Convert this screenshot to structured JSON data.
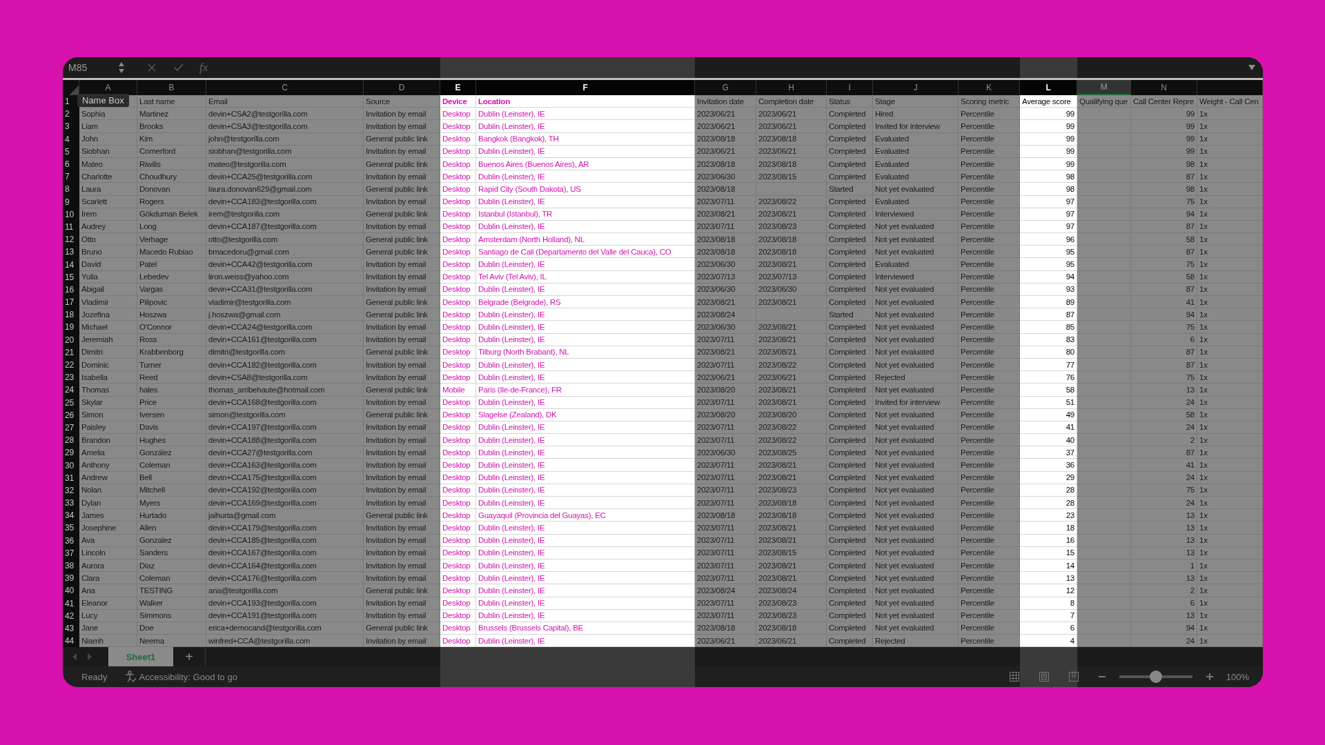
{
  "formula_bar": {
    "name_box": "M85",
    "function_label": "fx",
    "tooltip": "Name Box"
  },
  "columns": [
    {
      "letter": "A",
      "highlighted": false,
      "selected": false,
      "kind": "text"
    },
    {
      "letter": "B",
      "highlighted": false,
      "selected": false,
      "kind": "text"
    },
    {
      "letter": "C",
      "highlighted": false,
      "selected": false,
      "kind": "text"
    },
    {
      "letter": "D",
      "highlighted": false,
      "selected": false,
      "kind": "text"
    },
    {
      "letter": "E",
      "highlighted": true,
      "selected": false,
      "kind": "text",
      "color": "#d40fae"
    },
    {
      "letter": "F",
      "highlighted": true,
      "selected": false,
      "kind": "text",
      "color": "#d40fae"
    },
    {
      "letter": "G",
      "highlighted": false,
      "selected": false,
      "kind": "text"
    },
    {
      "letter": "H",
      "highlighted": false,
      "selected": false,
      "kind": "text"
    },
    {
      "letter": "I",
      "highlighted": false,
      "selected": false,
      "kind": "text"
    },
    {
      "letter": "J",
      "highlighted": false,
      "selected": false,
      "kind": "text"
    },
    {
      "letter": "K",
      "highlighted": false,
      "selected": false,
      "kind": "text"
    },
    {
      "letter": "L",
      "highlighted": true,
      "selected": false,
      "kind": "number"
    },
    {
      "letter": "M",
      "highlighted": false,
      "selected": true,
      "kind": "text"
    },
    {
      "letter": "N",
      "highlighted": false,
      "selected": false,
      "kind": "number"
    },
    {
      "highlighted": false,
      "selected": false,
      "kind": "text"
    }
  ],
  "rows": [
    {
      "n": "1",
      "cells": [
        null,
        "Last name",
        "Email",
        "Source",
        "Device",
        "Location",
        "Invitation date",
        "Completion date",
        "Status",
        "Stage",
        "Scoring metric",
        "Average score",
        "Qualifying que",
        "Call Center Repre",
        "Weight - Call Cen"
      ]
    },
    {
      "n": "2",
      "cells": [
        "Sophia",
        "Martinez",
        "devin+CSA2@testgorilla.com",
        "Invitation by email",
        "Desktop",
        "Dublin (Leinster), IE",
        "2023/06/21",
        "2023/06/21",
        "Completed",
        "Hired",
        "Percentile",
        "99",
        null,
        "99",
        "1x"
      ]
    },
    {
      "n": "3",
      "cells": [
        "Liam",
        "Brooks",
        "devin+CSA3@testgorilla.com",
        "Invitation by email",
        "Desktop",
        "Dublin (Leinster), IE",
        "2023/06/21",
        "2023/06/21",
        "Completed",
        "Invited for interview",
        "Percentile",
        "99",
        null,
        "99",
        "1x"
      ]
    },
    {
      "n": "4",
      "cells": [
        "John",
        "Kim",
        "john@testgorilla.com",
        "General public link",
        "Desktop",
        "Bangkok (Bangkok), TH",
        "2023/08/18",
        "2023/08/18",
        "Completed",
        "Evaluated",
        "Percentile",
        "99",
        null,
        "99",
        "1x"
      ]
    },
    {
      "n": "5",
      "cells": [
        "Siobhan",
        "Comerford",
        "siobhan@testgorilla.com",
        "Invitation by email",
        "Desktop",
        "Dublin (Leinster), IE",
        "2023/06/21",
        "2023/06/21",
        "Completed",
        "Evaluated",
        "Percentile",
        "99",
        null,
        "99",
        "1x"
      ]
    },
    {
      "n": "6",
      "cells": [
        "Mateo",
        "Riwilis",
        "mateo@testgorilla.com",
        "General public link",
        "Desktop",
        "Buenos Aires (Buenos Aires), AR",
        "2023/08/18",
        "2023/08/18",
        "Completed",
        "Evaluated",
        "Percentile",
        "99",
        null,
        "98",
        "1x"
      ]
    },
    {
      "n": "7",
      "cells": [
        "Charlotte",
        "Choudhury",
        "devin+CCA25@testgorilla.com",
        "Invitation by email",
        "Desktop",
        "Dublin (Leinster), IE",
        "2023/06/30",
        "2023/08/15",
        "Completed",
        "Evaluated",
        "Percentile",
        "98",
        null,
        "87",
        "1x"
      ]
    },
    {
      "n": "8",
      "cells": [
        "Laura",
        "Donovan",
        "laura.donovan629@gmail.com",
        "General public link",
        "Desktop",
        "Rapid City (South Dakota), US",
        "2023/08/18",
        null,
        "Started",
        "Not yet evaluated",
        "Percentile",
        "98",
        null,
        "98",
        "1x"
      ]
    },
    {
      "n": "9",
      "cells": [
        "Scarlett",
        "Rogers",
        "devin+CCA183@testgorilla.com",
        "Invitation by email",
        "Desktop",
        "Dublin (Leinster), IE",
        "2023/07/11",
        "2023/08/22",
        "Completed",
        "Evaluated",
        "Percentile",
        "97",
        null,
        "75",
        "1x"
      ]
    },
    {
      "n": "10",
      "cells": [
        "İrem",
        "Gökduman Belek",
        "irem@testgorilla.com",
        "General public link",
        "Desktop",
        "Istanbul (Istanbul), TR",
        "2023/08/21",
        "2023/08/21",
        "Completed",
        "Interviewed",
        "Percentile",
        "97",
        null,
        "94",
        "1x"
      ]
    },
    {
      "n": "11",
      "cells": [
        "Audrey",
        "Long",
        "devin+CCA187@testgorilla.com",
        "Invitation by email",
        "Desktop",
        "Dublin (Leinster), IE",
        "2023/07/11",
        "2023/08/23",
        "Completed",
        "Not yet evaluated",
        "Percentile",
        "97",
        null,
        "87",
        "1x"
      ]
    },
    {
      "n": "12",
      "cells": [
        "Otto",
        "Verhage",
        "otto@testgorilla.com",
        "General public link",
        "Desktop",
        "Amsterdam (North Holland), NL",
        "2023/08/18",
        "2023/08/18",
        "Completed",
        "Not yet evaluated",
        "Percentile",
        "96",
        null,
        "58",
        "1x"
      ]
    },
    {
      "n": "13",
      "cells": [
        "Bruno",
        "Macedo Rubiao",
        "bmacedoru@gmail.com",
        "General public link",
        "Desktop",
        "Santiago de Cali (Departamento del Valle del Cauca), CO",
        "2023/08/18",
        "2023/08/18",
        "Completed",
        "Not yet evaluated",
        "Percentile",
        "95",
        null,
        "87",
        "1x"
      ]
    },
    {
      "n": "14",
      "cells": [
        "David",
        "Patel",
        "devin+CCA42@testgorilla.com",
        "Invitation by email",
        "Desktop",
        "Dublin (Leinster), IE",
        "2023/06/30",
        "2023/08/21",
        "Completed",
        "Evaluated",
        "Percentile",
        "95",
        null,
        "75",
        "1x"
      ]
    },
    {
      "n": "15",
      "cells": [
        "Yulia",
        "Lebedev",
        "liron.weiss@yahoo.com",
        "Invitation by email",
        "Desktop",
        "Tel Aviv (Tel Aviv), IL",
        "2023/07/13",
        "2023/07/13",
        "Completed",
        "Interviewed",
        "Percentile",
        "94",
        null,
        "58",
        "1x"
      ]
    },
    {
      "n": "16",
      "cells": [
        "Abigail",
        "Vargas",
        "devin+CCA31@testgorilla.com",
        "Invitation by email",
        "Desktop",
        "Dublin (Leinster), IE",
        "2023/06/30",
        "2023/06/30",
        "Completed",
        "Not yet evaluated",
        "Percentile",
        "93",
        null,
        "87",
        "1x"
      ]
    },
    {
      "n": "17",
      "cells": [
        "Vladimir",
        "Pilipovic",
        "vladimir@testgorilla.com",
        "General public link",
        "Desktop",
        "Belgrade (Belgrade), RS",
        "2023/08/21",
        "2023/08/21",
        "Completed",
        "Not yet evaluated",
        "Percentile",
        "89",
        null,
        "41",
        "1x"
      ]
    },
    {
      "n": "18",
      "cells": [
        "Jozefina",
        "Hoszwa",
        "j.hoszwa@gmail.com",
        "General public link",
        "Desktop",
        "Dublin (Leinster), IE",
        "2023/08/24",
        null,
        "Started",
        "Not yet evaluated",
        "Percentile",
        "87",
        null,
        "94",
        "1x"
      ]
    },
    {
      "n": "19",
      "cells": [
        "Michael",
        "O'Connor",
        "devin+CCA24@testgorilla.com",
        "Invitation by email",
        "Desktop",
        "Dublin (Leinster), IE",
        "2023/06/30",
        "2023/08/21",
        "Completed",
        "Not yet evaluated",
        "Percentile",
        "85",
        null,
        "75",
        "1x"
      ]
    },
    {
      "n": "20",
      "cells": [
        "Jeremiah",
        "Ross",
        "devin+CCA161@testgorilla.com",
        "Invitation by email",
        "Desktop",
        "Dublin (Leinster), IE",
        "2023/07/11",
        "2023/08/21",
        "Completed",
        "Not yet evaluated",
        "Percentile",
        "83",
        null,
        "6",
        "1x"
      ]
    },
    {
      "n": "21",
      "cells": [
        "Dimitri",
        "Krabbenborg",
        "dimitri@testgorilla.com",
        "General public link",
        "Desktop",
        "Tilburg (North Brabant), NL",
        "2023/08/21",
        "2023/08/21",
        "Completed",
        "Not yet evaluated",
        "Percentile",
        "80",
        null,
        "87",
        "1x"
      ]
    },
    {
      "n": "22",
      "cells": [
        "Dominic",
        "Turner",
        "devin+CCA182@testgorilla.com",
        "Invitation by email",
        "Desktop",
        "Dublin (Leinster), IE",
        "2023/07/11",
        "2023/08/22",
        "Completed",
        "Not yet evaluated",
        "Percentile",
        "77",
        null,
        "87",
        "1x"
      ]
    },
    {
      "n": "23",
      "cells": [
        "Isabella",
        "Reed",
        "devin+CSA8@testgorilla.com",
        "Invitation by email",
        "Desktop",
        "Dublin (Leinster), IE",
        "2023/06/21",
        "2023/06/21",
        "Completed",
        "Rejected",
        "Percentile",
        "76",
        null,
        "75",
        "1x"
      ]
    },
    {
      "n": "24",
      "cells": [
        "Thomas",
        "hales",
        "thomas_arribehaute@hotmail.com",
        "General public link",
        "Mobile",
        "Paris (Ile-de-France), FR",
        "2023/08/20",
        "2023/08/21",
        "Completed",
        "Not yet evaluated",
        "Percentile",
        "58",
        null,
        "13",
        "1x"
      ]
    },
    {
      "n": "25",
      "cells": [
        "Skylar",
        "Price",
        "devin+CCA168@testgorilla.com",
        "Invitation by email",
        "Desktop",
        "Dublin (Leinster), IE",
        "2023/07/11",
        "2023/08/21",
        "Completed",
        "Invited for interview",
        "Percentile",
        "51",
        null,
        "24",
        "1x"
      ]
    },
    {
      "n": "26",
      "cells": [
        "Simon",
        "Iversen",
        "simon@testgorilla.com",
        "General public link",
        "Desktop",
        "Slagelse (Zealand), DK",
        "2023/08/20",
        "2023/08/20",
        "Completed",
        "Not yet evaluated",
        "Percentile",
        "49",
        null,
        "58",
        "1x"
      ]
    },
    {
      "n": "27",
      "cells": [
        "Paisley",
        "Davis",
        "devin+CCA197@testgorilla.com",
        "Invitation by email",
        "Desktop",
        "Dublin (Leinster), IE",
        "2023/07/11",
        "2023/08/22",
        "Completed",
        "Not yet evaluated",
        "Percentile",
        "41",
        null,
        "24",
        "1x"
      ]
    },
    {
      "n": "28",
      "cells": [
        "Brandon",
        "Hughes",
        "devin+CCA188@testgorilla.com",
        "Invitation by email",
        "Desktop",
        "Dublin (Leinster), IE",
        "2023/07/11",
        "2023/08/22",
        "Completed",
        "Not yet evaluated",
        "Percentile",
        "40",
        null,
        "2",
        "1x"
      ]
    },
    {
      "n": "29",
      "cells": [
        "Amelia",
        "González",
        "devin+CCA27@testgorilla.com",
        "Invitation by email",
        "Desktop",
        "Dublin (Leinster), IE",
        "2023/06/30",
        "2023/08/25",
        "Completed",
        "Not yet evaluated",
        "Percentile",
        "37",
        null,
        "87",
        "1x"
      ]
    },
    {
      "n": "30",
      "cells": [
        "Anthony",
        "Coleman",
        "devin+CCA163@testgorilla.com",
        "Invitation by email",
        "Desktop",
        "Dublin (Leinster), IE",
        "2023/07/11",
        "2023/08/21",
        "Completed",
        "Not yet evaluated",
        "Percentile",
        "36",
        null,
        "41",
        "1x"
      ]
    },
    {
      "n": "31",
      "cells": [
        "Andrew",
        "Bell",
        "devin+CCA175@testgorilla.com",
        "Invitation by email",
        "Desktop",
        "Dublin (Leinster), IE",
        "2023/07/11",
        "2023/08/21",
        "Completed",
        "Not yet evaluated",
        "Percentile",
        "29",
        null,
        "24",
        "1x"
      ]
    },
    {
      "n": "32",
      "cells": [
        "Nolan",
        "Mitchell",
        "devin+CCA192@testgorilla.com",
        "Invitation by email",
        "Desktop",
        "Dublin (Leinster), IE",
        "2023/07/11",
        "2023/08/23",
        "Completed",
        "Not yet evaluated",
        "Percentile",
        "28",
        null,
        "75",
        "1x"
      ]
    },
    {
      "n": "33",
      "cells": [
        "Dylan",
        "Myers",
        "devin+CCA169@testgorilla.com",
        "Invitation by email",
        "Desktop",
        "Dublin (Leinster), IE",
        "2023/07/11",
        "2023/08/18",
        "Completed",
        "Not yet evaluated",
        "Percentile",
        "28",
        null,
        "24",
        "1x"
      ]
    },
    {
      "n": "34",
      "cells": [
        "James",
        "Hurtado",
        "jaihurta@gmail.com",
        "General public link",
        "Desktop",
        "Guayaquil (Provincia del Guayas), EC",
        "2023/08/18",
        "2023/08/18",
        "Completed",
        "Not yet evaluated",
        "Percentile",
        "23",
        null,
        "13",
        "1x"
      ]
    },
    {
      "n": "35",
      "cells": [
        "Josephine",
        "Allen",
        "devin+CCA179@testgorilla.com",
        "Invitation by email",
        "Desktop",
        "Dublin (Leinster), IE",
        "2023/07/11",
        "2023/08/21",
        "Completed",
        "Not yet evaluated",
        "Percentile",
        "18",
        null,
        "13",
        "1x"
      ]
    },
    {
      "n": "36",
      "cells": [
        "Ava",
        "Gonzalez",
        "devin+CCA185@testgorilla.com",
        "Invitation by email",
        "Desktop",
        "Dublin (Leinster), IE",
        "2023/07/11",
        "2023/08/21",
        "Completed",
        "Not yet evaluated",
        "Percentile",
        "16",
        null,
        "13",
        "1x"
      ]
    },
    {
      "n": "37",
      "cells": [
        "Lincoln",
        "Sanders",
        "devin+CCA167@testgorilla.com",
        "Invitation by email",
        "Desktop",
        "Dublin (Leinster), IE",
        "2023/07/11",
        "2023/08/15",
        "Completed",
        "Not yet evaluated",
        "Percentile",
        "15",
        null,
        "13",
        "1x"
      ]
    },
    {
      "n": "38",
      "cells": [
        "Aurora",
        "Diaz",
        "devin+CCA164@testgorilla.com",
        "Invitation by email",
        "Desktop",
        "Dublin (Leinster), IE",
        "2023/07/11",
        "2023/08/21",
        "Completed",
        "Not yet evaluated",
        "Percentile",
        "14",
        null,
        "1",
        "1x"
      ]
    },
    {
      "n": "39",
      "cells": [
        "Clara",
        "Coleman",
        "devin+CCA176@testgorilla.com",
        "Invitation by email",
        "Desktop",
        "Dublin (Leinster), IE",
        "2023/07/11",
        "2023/08/21",
        "Completed",
        "Not yet evaluated",
        "Percentile",
        "13",
        null,
        "13",
        "1x"
      ]
    },
    {
      "n": "40",
      "cells": [
        "Ana",
        "TESTING",
        "ana@testgorilla.com",
        "General public link",
        "Desktop",
        "Dublin (Leinster), IE",
        "2023/08/24",
        "2023/08/24",
        "Completed",
        "Not yet evaluated",
        "Percentile",
        "12",
        null,
        "2",
        "1x"
      ]
    },
    {
      "n": "41",
      "cells": [
        "Eleanor",
        "Walker",
        "devin+CCA193@testgorilla.com",
        "Invitation by email",
        "Desktop",
        "Dublin (Leinster), IE",
        "2023/07/11",
        "2023/08/23",
        "Completed",
        "Not yet evaluated",
        "Percentile",
        "8",
        null,
        "6",
        "1x"
      ]
    },
    {
      "n": "42",
      "cells": [
        "Lucy",
        "Simmons",
        "devin+CCA191@testgorilla.com",
        "Invitation by email",
        "Desktop",
        "Dublin (Leinster), IE",
        "2023/07/11",
        "2023/08/23",
        "Completed",
        "Not yet evaluated",
        "Percentile",
        "7",
        null,
        "13",
        "1x"
      ]
    },
    {
      "n": "43",
      "cells": [
        "Jane",
        "Doe",
        "erica+democand@testgorilla.com",
        "General public link",
        "Desktop",
        "Brussels (Brussels Capital), BE",
        "2023/08/18",
        "2023/08/18",
        "Completed",
        "Not yet evaluated",
        "Percentile",
        "6",
        null,
        "94",
        "1x"
      ]
    },
    {
      "n": "44",
      "cells": [
        "Niamh",
        "Neema",
        "winfred+CCA@testgorilla.com",
        "Invitation by email",
        "Desktop",
        "Dublin (Leinster), IE",
        "2023/06/21",
        "2023/06/21",
        "Completed",
        "Rejected",
        "Percentile",
        "4",
        null,
        "24",
        "1x"
      ]
    }
  ],
  "sheet_tabs": [
    {
      "label": "Sheet1",
      "selected": true
    }
  ],
  "add_sheet": "+",
  "status_bar": {
    "mode": "Ready",
    "accessibility": "Accessibility: Good to go",
    "zoom": {
      "level": 0.5,
      "reading": "100%"
    }
  }
}
